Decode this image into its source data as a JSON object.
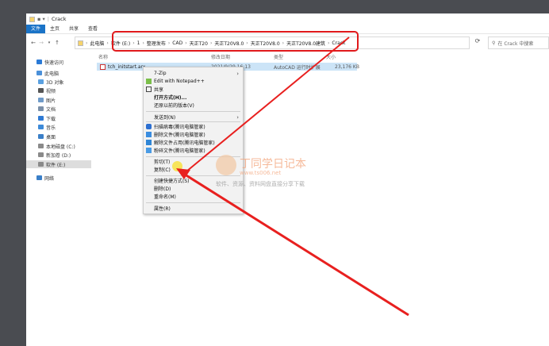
{
  "window": {
    "title": "Crack",
    "ribbon_tabs": [
      "文件",
      "主页",
      "共享",
      "查看"
    ]
  },
  "address": {
    "crumbs": [
      "此电脑",
      "软件 (E:)",
      "1",
      "整理发布",
      "CAD",
      "天正T20",
      "天正T20V8.0",
      "天正T20V8.0",
      "天正T20V8.0建筑",
      "Crack"
    ],
    "separator": "›"
  },
  "search": {
    "placeholder": "在 Crack 中搜索"
  },
  "sidebar": {
    "items": [
      {
        "label": "快速访问",
        "color": "#2a7ad6"
      },
      {
        "label": "此电脑",
        "color": "#4a90d9"
      },
      {
        "label": "3D 对象",
        "color": "#5aa0e0"
      },
      {
        "label": "视频",
        "color": "#555555"
      },
      {
        "label": "图片",
        "color": "#6f9bc9"
      },
      {
        "label": "文档",
        "color": "#7a8fa8"
      },
      {
        "label": "下载",
        "color": "#2f7ad4"
      },
      {
        "label": "音乐",
        "color": "#3d8ad8"
      },
      {
        "label": "桌面",
        "color": "#3a7fc8"
      },
      {
        "label": "本地磁盘 (C:)",
        "color": "#8a8a8a"
      },
      {
        "label": "新加卷 (D:)",
        "color": "#8a8a8a"
      },
      {
        "label": "软件 (E:)",
        "color": "#8a8a8a"
      },
      {
        "label": "网络",
        "color": "#3a7fc8"
      }
    ]
  },
  "columns": [
    "名称",
    "修改日期",
    "类型",
    "大小"
  ],
  "file": {
    "name": "tch_initstart.arx",
    "date": "2021/9/29 16:13",
    "type": "AutoCAD 运行时扩展",
    "size": "23,176 KB"
  },
  "context_menu": {
    "items": [
      {
        "label": "7-Zip",
        "arrow": "›",
        "icon": "none"
      },
      {
        "label": "Edit with Notepad++",
        "icon": "notepad-icon"
      },
      {
        "label": "共享",
        "icon": "share-icon"
      },
      {
        "label": "打开方式(H)...",
        "bold": true
      },
      {
        "label": "还原以前的版本(V)"
      },
      {
        "label": "发送到(N)",
        "arrow": "›"
      },
      {
        "label": "扫描病毒(腾讯电脑管家)",
        "icon": "shield-icon"
      },
      {
        "label": "删除文件(腾讯电脑管家)",
        "icon": "trash-icon"
      },
      {
        "label": "解除文件占用(腾讯电脑管家)",
        "icon": "unlock-icon"
      },
      {
        "label": "粉碎文件(腾讯电脑管家)",
        "icon": "shred-icon"
      },
      {
        "label": "剪切(T)"
      },
      {
        "label": "复制(C)"
      },
      {
        "label": "创建快捷方式(S)"
      },
      {
        "label": "删除(D)"
      },
      {
        "label": "重命名(M)"
      },
      {
        "label": "属性(R)"
      }
    ]
  },
  "watermark": {
    "title": "丁同学日记本",
    "url": "www.ts006.net",
    "slogan": "软件、资源、资料网盘直接分享下载"
  },
  "colors": {
    "accent": "#1a73c7",
    "selection": "#cce4f7",
    "highlight_box": "#e0191b",
    "annotation_arrow": "#e8201f"
  }
}
